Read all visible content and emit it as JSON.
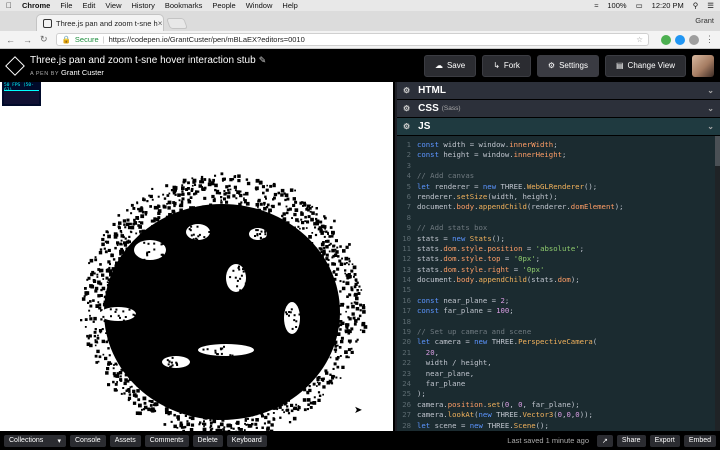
{
  "mac_menu": {
    "app_name": "Chrome",
    "items": [
      "File",
      "Edit",
      "View",
      "History",
      "Bookmarks",
      "People",
      "Window",
      "Help"
    ],
    "clock": "12:20 PM",
    "battery": "100%"
  },
  "browser": {
    "tab_title": "Three.js pan and zoom t-sne h",
    "profile_name": "Grant",
    "secure_label": "Secure",
    "url": "https://codepen.io/GrantCuster/pen/mBLaEX?editors=0010"
  },
  "pen": {
    "title": "Three.js pan and zoom t-sne hover interaction stub",
    "author_prefix": "A PEN BY",
    "author": "Grant Custer",
    "buttons": {
      "save": "Save",
      "fork": "Fork",
      "settings": "Settings",
      "change_view": "Change View"
    }
  },
  "result": {
    "fps_label": "50 FPS (50-63)",
    "icon": "mouse-cursor-icon"
  },
  "editor": {
    "panels": {
      "html": "HTML",
      "css": "CSS",
      "css_sub": "(Sass)",
      "js": "JS"
    },
    "code_lines": [
      {
        "n": "1",
        "text": "const width = window.innerWidth;"
      },
      {
        "n": "2",
        "text": "const height = window.innerHeight;"
      },
      {
        "n": "3",
        "text": ""
      },
      {
        "n": "4",
        "text": "// Add canvas"
      },
      {
        "n": "5",
        "text": "let renderer = new THREE.WebGLRenderer();"
      },
      {
        "n": "6",
        "text": "renderer.setSize(width, height);"
      },
      {
        "n": "7",
        "text": "document.body.appendChild(renderer.domElement);"
      },
      {
        "n": "8",
        "text": ""
      },
      {
        "n": "9",
        "text": "// Add stats box"
      },
      {
        "n": "10",
        "text": "stats = new Stats();"
      },
      {
        "n": "11",
        "text": "stats.dom.style.position = 'absolute';"
      },
      {
        "n": "12",
        "text": "stats.dom.style.top = '0px';"
      },
      {
        "n": "13",
        "text": "stats.dom.style.right = '0px'"
      },
      {
        "n": "14",
        "text": "document.body.appendChild(stats.dom);"
      },
      {
        "n": "15",
        "text": ""
      },
      {
        "n": "16",
        "text": "const near_plane = 2;"
      },
      {
        "n": "17",
        "text": "const far_plane = 100;"
      },
      {
        "n": "18",
        "text": ""
      },
      {
        "n": "19",
        "text": "// Set up camera and scene"
      },
      {
        "n": "20",
        "text": "let camera = new THREE.PerspectiveCamera("
      },
      {
        "n": "21",
        "text": "  20,"
      },
      {
        "n": "22",
        "text": "  width / height,"
      },
      {
        "n": "23",
        "text": "  near_plane,"
      },
      {
        "n": "24",
        "text": "  far_plane"
      },
      {
        "n": "25",
        "text": ");"
      },
      {
        "n": "26",
        "text": "camera.position.set(0, 0, far_plane);"
      },
      {
        "n": "27",
        "text": "camera.lookAt(new THREE.Vector3(0,0,0));"
      },
      {
        "n": "28",
        "text": "let scene = new THREE.Scene();"
      }
    ]
  },
  "bottom_bar": {
    "collections": "Collections",
    "console": "Console",
    "assets": "Assets",
    "comments": "Comments",
    "delete": "Delete",
    "keyboard": "Keyboard",
    "last_saved": "Last saved 1 minute ago",
    "share": "Share",
    "export": "Export",
    "embed": "Embed"
  },
  "colors": {
    "editor_bg": "#1b2b30",
    "header_bg": "#000000",
    "keyword": "#5c95ff",
    "function": "#f2b25c",
    "string": "#8fcc6e"
  }
}
